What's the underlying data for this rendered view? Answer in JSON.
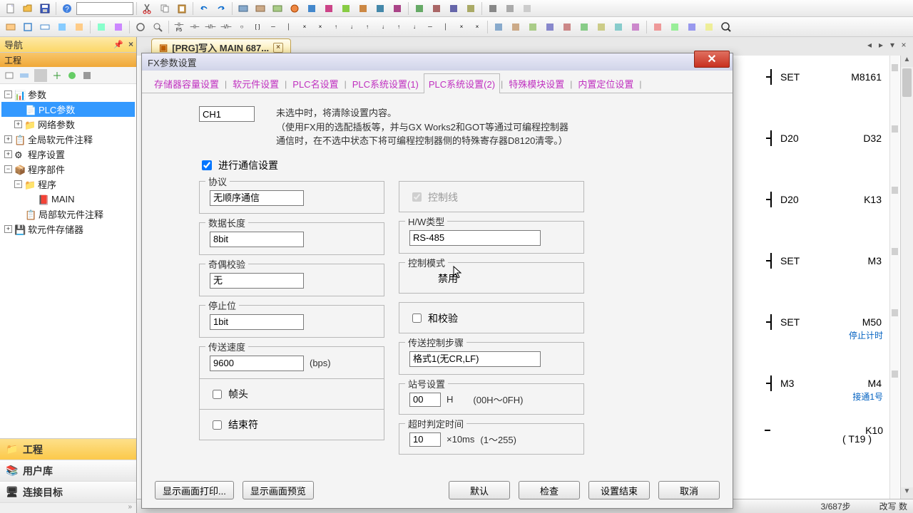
{
  "nav": {
    "title": "导航",
    "sub": "工程",
    "tree": {
      "params": "参数",
      "plc_params": "PLC参数",
      "net_params": "网络参数",
      "global_dev": "全局软元件注释",
      "prog_set": "程序设置",
      "prog_parts": "程序部件",
      "program": "程序",
      "main": "MAIN",
      "local_dev": "局部软元件注释",
      "dev_mem": "软元件存储器"
    },
    "bottom": {
      "project": "工程",
      "userlib": "用户库",
      "connect": "连接目标",
      "strip": "»"
    }
  },
  "tab": {
    "label": "[PRG]写入 MAIN 687..."
  },
  "dialog": {
    "title": "FX参数设置",
    "tabs": {
      "t1": "存储器容量设置",
      "t2": "软元件设置",
      "t3": "PLC名设置",
      "t4": "PLC系统设置(1)",
      "t5": "PLC系统设置(2)",
      "t6": "特殊模块设置",
      "t7": "内置定位设置"
    },
    "ch": "CH1",
    "hint1": "未选中时，将清除设置内容。",
    "hint2": "（使用FX用的选配插板等，并与GX Works2和GOT等通过可编程控制器",
    "hint3": "通信时，在不选中状态下将可编程控制器侧的特殊寄存器D8120清零。）",
    "enable_comm": "进行通信设置",
    "protocol": {
      "label": "协议",
      "value": "无顺序通信"
    },
    "datalen": {
      "label": "数据长度",
      "value": "8bit"
    },
    "parity": {
      "label": "奇偶校验",
      "value": "无"
    },
    "stopbit": {
      "label": "停止位",
      "value": "1bit"
    },
    "baud": {
      "label": "传送速度",
      "value": "9600",
      "unit": "(bps)"
    },
    "header": {
      "label": "帧头"
    },
    "terminator": {
      "label": "结束符"
    },
    "ctrlline": {
      "label": "控制线"
    },
    "hwtype": {
      "label": "H/W类型",
      "value": "RS-485"
    },
    "ctrlmode": {
      "label": "控制模式",
      "value": "禁用"
    },
    "sumcheck": {
      "label": "和校验"
    },
    "txctrl": {
      "label": "传送控制步骤",
      "value": "格式1(无CR,LF)"
    },
    "station": {
      "label": "站号设置",
      "value": "00",
      "suffix": "H",
      "range": "(00H～0FH)"
    },
    "timeout": {
      "label": "超时判定时间",
      "value": "10",
      "suffix": "×10ms",
      "range": "(1～255)"
    },
    "buttons": {
      "print": "显示画面打印...",
      "preview": "显示画面预览",
      "default": "默认",
      "check": "检查",
      "end": "设置结束",
      "cancel": "取消"
    }
  },
  "ladder": {
    "r1": {
      "op": "SET",
      "dev": "M8161"
    },
    "r2": {
      "a": "D20",
      "b": "D32"
    },
    "r3": {
      "a": "D20",
      "b": "K13"
    },
    "r4": {
      "op": "SET",
      "dev": "M3"
    },
    "r5": {
      "op": "SET",
      "dev": "M50",
      "note": "停止计时"
    },
    "r6": {
      "a": "M3",
      "b": "M4",
      "note": "接通1号"
    },
    "r7": {
      "b": "K10",
      "t": "T19"
    }
  },
  "status": {
    "steps": "3/687步",
    "mode": "改写 数"
  }
}
